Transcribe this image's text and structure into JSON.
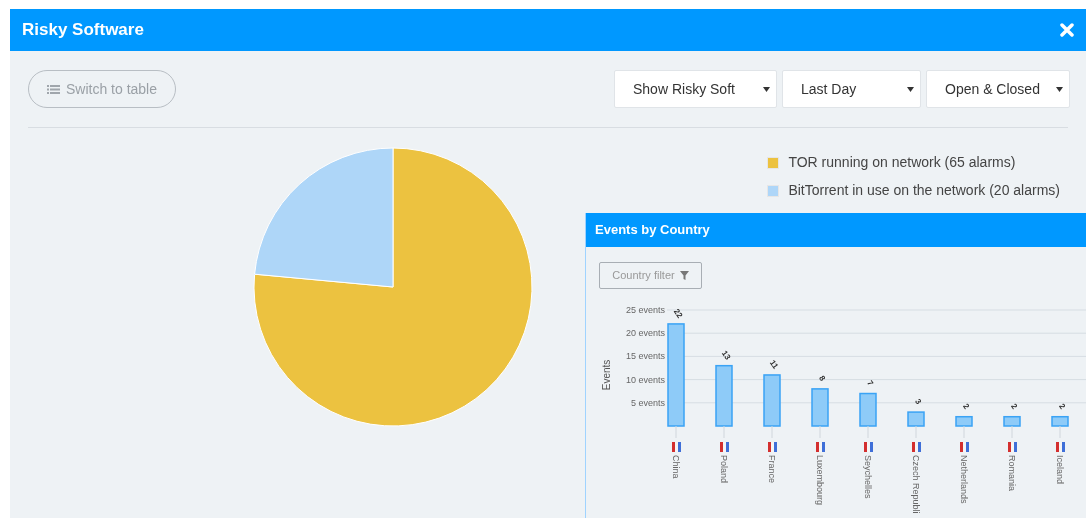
{
  "window": {
    "title": "Risky Software"
  },
  "toolbar": {
    "switch_button": "Switch to table",
    "selects": [
      {
        "value": "Show Risky Soft"
      },
      {
        "value": "Last Day"
      },
      {
        "value": "Open & Closed"
      }
    ]
  },
  "legend": [
    {
      "color": "#ecc240"
    },
    {
      "color": "#aed6f8"
    }
  ],
  "pie": {
    "chart_data": {
      "type": "pie",
      "categories": [
        "TOR running on network (65 alarms)",
        "BitTorrent in use on the network (20 alarms)"
      ],
      "values": [
        65,
        20
      ]
    }
  },
  "events_panel": {
    "title": "Events by Country",
    "filter_button": "Country filter",
    "chart_data": {
      "type": "bar",
      "ylabel": "Events",
      "categories": [
        "China",
        "Poland",
        "France",
        "Luxembourg",
        "Seychelles",
        "Czech Republi",
        "Netherlands",
        "Romania",
        "Iceland"
      ],
      "series": [
        {
          "color": "#8ecbf8",
          "values": [
            22,
            13,
            11,
            8,
            7,
            3,
            2,
            2,
            2
          ]
        }
      ],
      "ylim": [
        0,
        25
      ],
      "yticks": [
        {
          "value": 5,
          "label": "5 events"
        },
        {
          "value": 10,
          "label": "10 events"
        },
        {
          "value": 15,
          "label": "15 events"
        },
        {
          "value": 20,
          "label": "20 events"
        },
        {
          "value": 25,
          "label": "25 events"
        }
      ],
      "grid": true,
      "data_labels": true
    }
  }
}
